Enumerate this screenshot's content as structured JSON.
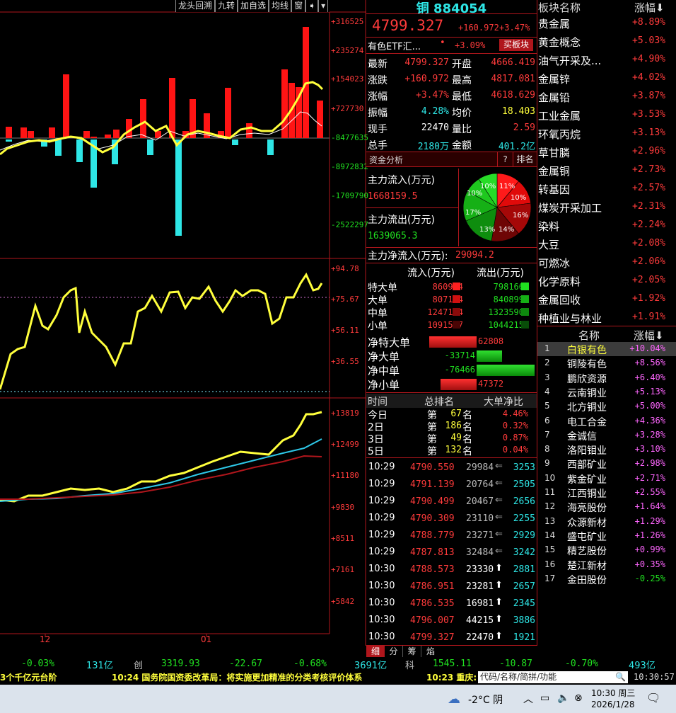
{
  "toolbar": {
    "btn1": "龙头回溯",
    "btn2": "九转",
    "btn3": "加自选",
    "btn4": "均线",
    "btn5": "窗",
    "arrow_icon": "arrow-right-icon",
    "menu_icon": "triangle-down-icon"
  },
  "chart": {
    "top_axis": [
      "+316525",
      "+235274",
      "+154023",
      "+727730",
      "-8477635",
      "-8972832",
      "-1709790",
      "-2522297"
    ],
    "mid_axis": [
      "+94.78",
      "+75.67",
      "+56.11",
      "+36.55"
    ],
    "bot_axis": [
      "+13819",
      "+12499",
      "+11180",
      "+9830",
      "+8511",
      "+7161",
      "+5842"
    ],
    "x_labels": [
      "12",
      "01"
    ]
  },
  "quote": {
    "name": "铜 884054",
    "price": "4799.327",
    "change": "+160.972",
    "change_pct": "+3.47%",
    "etf_name": "有色ETF汇...",
    "etf_dot": "•",
    "etf_pct": "+3.09%",
    "buy_block": "买板块",
    "rows": [
      {
        "l1": "最新",
        "v1": "4799.327",
        "l2": "开盘",
        "v2": "4666.419"
      },
      {
        "l1": "涨跌",
        "v1": "+160.972",
        "l2": "最高",
        "v2": "4817.081"
      },
      {
        "l1": "涨幅",
        "v1": "+3.47%",
        "l2": "最低",
        "v2": "4618.629"
      },
      {
        "l1": "振幅",
        "v1": "4.28%",
        "l2": "均价",
        "v2": "18.403"
      },
      {
        "l1": "现手",
        "v1": "22470",
        "l2": "量比",
        "v2": "2.59"
      },
      {
        "l1": "总手",
        "v1": "2180万",
        "l2": "金额",
        "v2": "401.2亿"
      }
    ],
    "fund_title": "资金分析",
    "fund_q": "?",
    "fund_rank": "排名",
    "inflow_label": "主力流入(万元)",
    "inflow_value": "1668159.5",
    "outflow_label": "主力流出(万元)",
    "outflow_value": "1639065.3",
    "net_label": "主力净流入(万元):",
    "net_value": "29094.2",
    "pie": [
      "11%",
      "10%",
      "16%",
      "14%",
      "13%",
      "17%",
      "10%",
      "10%"
    ],
    "flow_header": [
      "流入(万元)",
      "流出(万元)"
    ],
    "flow_rows": [
      {
        "label": "特大单",
        "in": "860974",
        "out": "798166"
      },
      {
        "label": "大单",
        "in": "807184",
        "out": "840899"
      },
      {
        "label": "中单",
        "in": "1247124",
        "out": "1323590"
      },
      {
        "label": "小单",
        "in": "1091587",
        "out": "1044215"
      }
    ],
    "net_rows": [
      {
        "label": "净特大单",
        "value": "62808"
      },
      {
        "label": "净大单",
        "value": "-33714"
      },
      {
        "label": "净中单",
        "value": "-76466"
      },
      {
        "label": "净小单",
        "value": "47372"
      }
    ],
    "rank_header": [
      "时间",
      "总排名",
      "大单净比"
    ],
    "rank_rows": [
      {
        "t": "今日",
        "p": "第",
        "r": "67",
        "m": "名",
        "v": "4.46%"
      },
      {
        "t": "2日",
        "p": "第",
        "r": "186",
        "m": "名",
        "v": "0.32%"
      },
      {
        "t": "3日",
        "p": "第",
        "r": "49",
        "m": "名",
        "v": "0.87%"
      },
      {
        "t": "5日",
        "p": "第",
        "r": "132",
        "m": "名",
        "v": "0.04%"
      }
    ],
    "ticks": [
      {
        "t": "10:29",
        "p": "4790.550",
        "v": "29984",
        "up": false,
        "n": "3253"
      },
      {
        "t": "10:29",
        "p": "4791.139",
        "v": "20764",
        "up": false,
        "n": "2505"
      },
      {
        "t": "10:29",
        "p": "4790.499",
        "v": "20467",
        "up": false,
        "n": "2656"
      },
      {
        "t": "10:29",
        "p": "4790.309",
        "v": "23110",
        "up": false,
        "n": "2255"
      },
      {
        "t": "10:29",
        "p": "4788.779",
        "v": "23271",
        "up": false,
        "n": "2929"
      },
      {
        "t": "10:29",
        "p": "4787.813",
        "v": "32484",
        "up": false,
        "n": "3242"
      },
      {
        "t": "10:30",
        "p": "4788.573",
        "v": "23330",
        "up": true,
        "n": "2881"
      },
      {
        "t": "10:30",
        "p": "4786.951",
        "v": "23281",
        "up": true,
        "n": "2657"
      },
      {
        "t": "10:30",
        "p": "4786.535",
        "v": "16981",
        "up": true,
        "n": "2345"
      },
      {
        "t": "10:30",
        "p": "4796.007",
        "v": "44215",
        "up": true,
        "n": "3886"
      },
      {
        "t": "10:30",
        "p": "4799.327",
        "v": "22470",
        "up": true,
        "n": "1921"
      }
    ],
    "tabs": [
      "细",
      "分",
      "筹",
      "焰"
    ]
  },
  "sectors": {
    "header_name": "板块名称",
    "header_pct": "涨幅",
    "items": [
      {
        "n": "贵金属",
        "v": "+8.89%"
      },
      {
        "n": "黄金概念",
        "v": "+5.03%"
      },
      {
        "n": "油气开采及...",
        "v": "+4.90%"
      },
      {
        "n": "金属锌",
        "v": "+4.02%"
      },
      {
        "n": "金属铅",
        "v": "+3.87%"
      },
      {
        "n": "工业金属",
        "v": "+3.53%"
      },
      {
        "n": "环氧丙烷",
        "v": "+3.13%"
      },
      {
        "n": "草甘膦",
        "v": "+2.96%"
      },
      {
        "n": "金属铜",
        "v": "+2.73%"
      },
      {
        "n": "转基因",
        "v": "+2.57%"
      },
      {
        "n": "煤炭开采加工",
        "v": "+2.31%"
      },
      {
        "n": "染料",
        "v": "+2.24%"
      },
      {
        "n": "大豆",
        "v": "+2.08%"
      },
      {
        "n": "可燃冰",
        "v": "+2.06%"
      },
      {
        "n": "化学原料",
        "v": "+2.05%"
      },
      {
        "n": "金属回收",
        "v": "+1.92%"
      },
      {
        "n": "种植业与林业",
        "v": "+1.91%"
      }
    ]
  },
  "stocks": {
    "header_name": "名称",
    "header_pct": "涨幅",
    "items": [
      {
        "i": "1",
        "n": "白银有色",
        "v": "+10.04%"
      },
      {
        "i": "2",
        "n": "铜陵有色",
        "v": "+8.56%"
      },
      {
        "i": "3",
        "n": "鹏欣资源",
        "v": "+6.40%"
      },
      {
        "i": "4",
        "n": "云南铜业",
        "v": "+5.13%"
      },
      {
        "i": "5",
        "n": "北方铜业",
        "v": "+5.00%"
      },
      {
        "i": "6",
        "n": "电工合金",
        "v": "+4.36%"
      },
      {
        "i": "7",
        "n": "金诚信",
        "v": "+3.28%"
      },
      {
        "i": "8",
        "n": "洛阳钼业",
        "v": "+3.10%"
      },
      {
        "i": "9",
        "n": "西部矿业",
        "v": "+2.98%"
      },
      {
        "i": "10",
        "n": "紫金矿业",
        "v": "+2.71%"
      },
      {
        "i": "11",
        "n": "江西铜业",
        "v": "+2.55%"
      },
      {
        "i": "12",
        "n": "海亮股份",
        "v": "+1.64%"
      },
      {
        "i": "13",
        "n": "众源新材",
        "v": "+1.29%"
      },
      {
        "i": "14",
        "n": "盛屯矿业",
        "v": "+1.26%"
      },
      {
        "i": "15",
        "n": "精艺股份",
        "v": "+0.99%"
      },
      {
        "i": "16",
        "n": "楚江新材",
        "v": "+0.35%"
      },
      {
        "i": "17",
        "n": "金田股份",
        "v": "-0.25%"
      }
    ]
  },
  "status": {
    "a": "-0.03%",
    "b": "131亿",
    "c": "创",
    "d": "3319.93",
    "e": "-22.67",
    "f": "-0.68%",
    "g": "3691亿",
    "h": "科",
    "i": "1545.11",
    "j": "-10.87",
    "k": "-0.70%",
    "l": "493亿"
  },
  "ticker": {
    "left": "3个千亿元台阶",
    "news1": "10:24 国务院国资委改革局：将实施更加精准的分类考核评价体系",
    "news2": "10:23 重庆:",
    "search_placeholder": "代码/名称/简拼/功能",
    "clock": "10:30:57"
  },
  "taskbar": {
    "weather": "-2°C 阴",
    "time": "10:30 周三",
    "date": "2026/1/28"
  }
}
